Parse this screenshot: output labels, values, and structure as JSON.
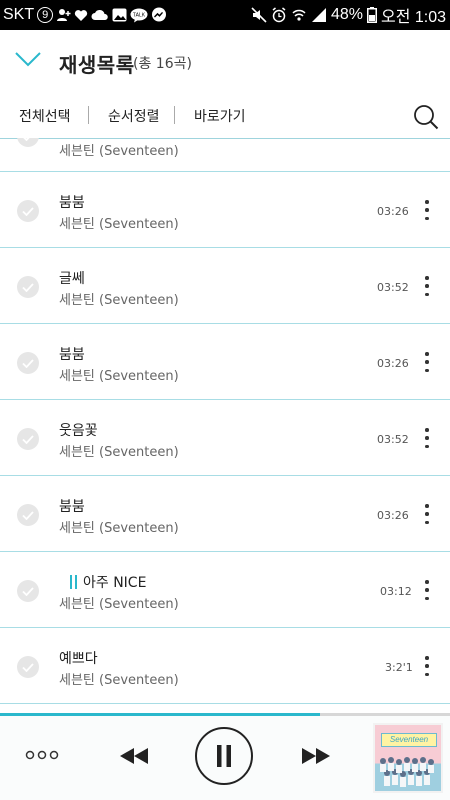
{
  "status_bar": {
    "carrier": "SKT",
    "carrier_badge": "9",
    "battery_percent": "48%",
    "time": "오전 1:03"
  },
  "header": {
    "title": "재생목록",
    "count": "(총 16곡)"
  },
  "toolbar": {
    "select_all": "전체선택",
    "sort": "순서정렬",
    "shortcut": "바로가기"
  },
  "playlist": {
    "partial_row_artist": "세븐틴 (Seventeen)",
    "songs": [
      {
        "title": "붐붐",
        "artist": "세븐틴 (Seventeen)",
        "duration": "03:26",
        "playing": false
      },
      {
        "title": "글쎄",
        "artist": "세븐틴 (Seventeen)",
        "duration": "03:52",
        "playing": false
      },
      {
        "title": "붐붐",
        "artist": "세븐틴 (Seventeen)",
        "duration": "03:26",
        "playing": false
      },
      {
        "title": "웃음꽃",
        "artist": "세븐틴 (Seventeen)",
        "duration": "03:52",
        "playing": false
      },
      {
        "title": "붐붐",
        "artist": "세븐틴 (Seventeen)",
        "duration": "03:26",
        "playing": false
      },
      {
        "title": "아주 NICE",
        "artist": "세븐틴 (Seventeen)",
        "duration": "03:12",
        "playing": true
      },
      {
        "title": "예쁘다",
        "artist": "세븐틴 (Seventeen)",
        "duration": "3:2'1",
        "playing": false
      }
    ]
  },
  "player": {
    "progress_fraction": 0.71,
    "state": "playing",
    "album_art_text": "Seventeen"
  },
  "colors": {
    "accent": "#2ab8cc",
    "divider": "#a8dde5"
  }
}
